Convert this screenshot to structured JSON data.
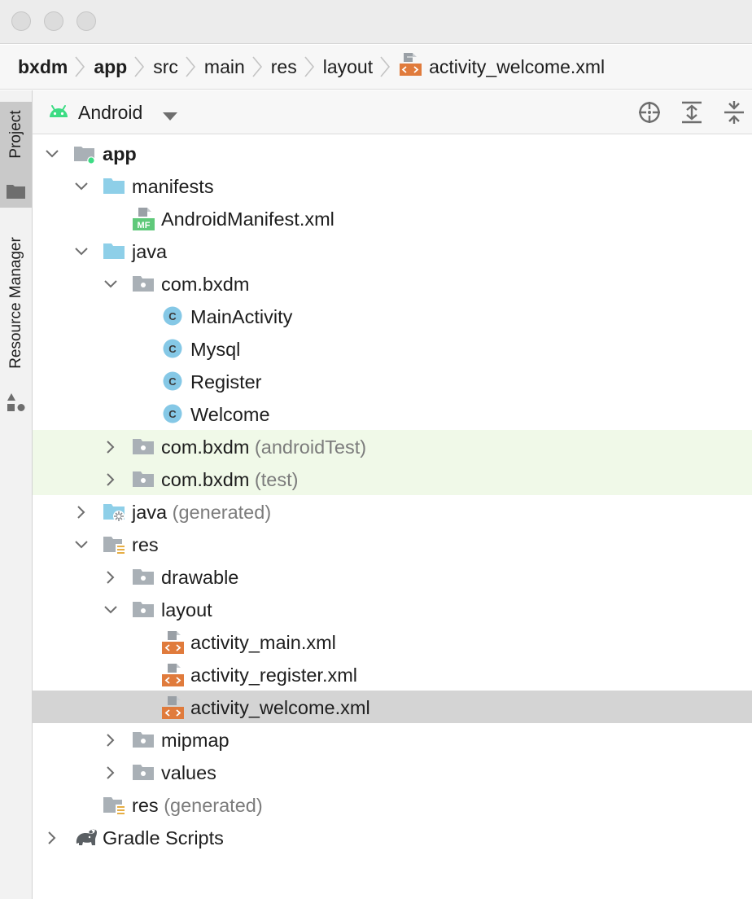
{
  "breadcrumb": {
    "items": [
      "bxdm",
      "app",
      "src",
      "main",
      "res",
      "layout"
    ],
    "file": "activity_welcome.xml"
  },
  "sidebar": {
    "tabs": [
      {
        "label": "Project",
        "active": true
      },
      {
        "label": "Resource Manager",
        "active": false
      }
    ]
  },
  "panel": {
    "view_mode": "Android",
    "actions": [
      "locate-icon",
      "expand-all-icon",
      "collapse-all-icon"
    ]
  },
  "tree": [
    {
      "label": "app",
      "suffix": "",
      "bold": true,
      "depth": 0,
      "state": "expanded",
      "icon": "module-icon"
    },
    {
      "label": "manifests",
      "suffix": "",
      "depth": 1,
      "state": "expanded",
      "icon": "folder-icon"
    },
    {
      "label": "AndroidManifest.xml",
      "suffix": "",
      "depth": 2,
      "state": "leaf",
      "icon": "manifest-file-icon",
      "badge": "MF"
    },
    {
      "label": "java",
      "suffix": "",
      "depth": 1,
      "state": "expanded",
      "icon": "folder-icon"
    },
    {
      "label": "com.bxdm",
      "suffix": "",
      "depth": 2,
      "state": "expanded",
      "icon": "package-icon"
    },
    {
      "label": "MainActivity",
      "suffix": "",
      "depth": 3,
      "state": "leaf",
      "icon": "class-icon",
      "badge": "C"
    },
    {
      "label": "Mysql",
      "suffix": "",
      "depth": 3,
      "state": "leaf",
      "icon": "class-icon",
      "badge": "C"
    },
    {
      "label": "Register",
      "suffix": "",
      "depth": 3,
      "state": "leaf",
      "icon": "class-icon",
      "badge": "C"
    },
    {
      "label": "Welcome",
      "suffix": "",
      "depth": 3,
      "state": "leaf",
      "icon": "class-icon",
      "badge": "C"
    },
    {
      "label": "com.bxdm",
      "suffix": "(androidTest)",
      "depth": 2,
      "state": "collapsed",
      "icon": "package-icon",
      "tint": true
    },
    {
      "label": "com.bxdm",
      "suffix": "(test)",
      "depth": 2,
      "state": "collapsed",
      "icon": "package-icon",
      "tint": true
    },
    {
      "label": "java",
      "suffix": "(generated)",
      "depth": 1,
      "state": "collapsed",
      "icon": "generated-folder-icon"
    },
    {
      "label": "res",
      "suffix": "",
      "depth": 1,
      "state": "expanded",
      "icon": "resource-folder-icon"
    },
    {
      "label": "drawable",
      "suffix": "",
      "depth": 2,
      "state": "collapsed",
      "icon": "package-icon"
    },
    {
      "label": "layout",
      "suffix": "",
      "depth": 2,
      "state": "expanded",
      "icon": "package-icon"
    },
    {
      "label": "activity_main.xml",
      "suffix": "",
      "depth": 3,
      "state": "leaf",
      "icon": "layout-file-icon"
    },
    {
      "label": "activity_register.xml",
      "suffix": "",
      "depth": 3,
      "state": "leaf",
      "icon": "layout-file-icon"
    },
    {
      "label": "activity_welcome.xml",
      "suffix": "",
      "depth": 3,
      "state": "leaf",
      "icon": "layout-file-icon",
      "selected": true
    },
    {
      "label": "mipmap",
      "suffix": "",
      "depth": 2,
      "state": "collapsed",
      "icon": "package-icon"
    },
    {
      "label": "values",
      "suffix": "",
      "depth": 2,
      "state": "collapsed",
      "icon": "package-icon"
    },
    {
      "label": "res",
      "suffix": "(generated)",
      "depth": 1,
      "state": "leaf",
      "icon": "resource-folder-icon"
    },
    {
      "label": "Gradle Scripts",
      "suffix": "",
      "depth": 0,
      "state": "collapsed",
      "icon": "gradle-icon"
    }
  ],
  "colors": {
    "folder": "#8ecfe8",
    "package": "#a9b0b6",
    "class_badge": "#85c8e6",
    "layout_badge": "#e07b3c",
    "manifest_badge": "#5fc97a",
    "android": "#3ddc84",
    "tint_row": "#f0f9e8",
    "selected_row": "#d4d4d4"
  }
}
